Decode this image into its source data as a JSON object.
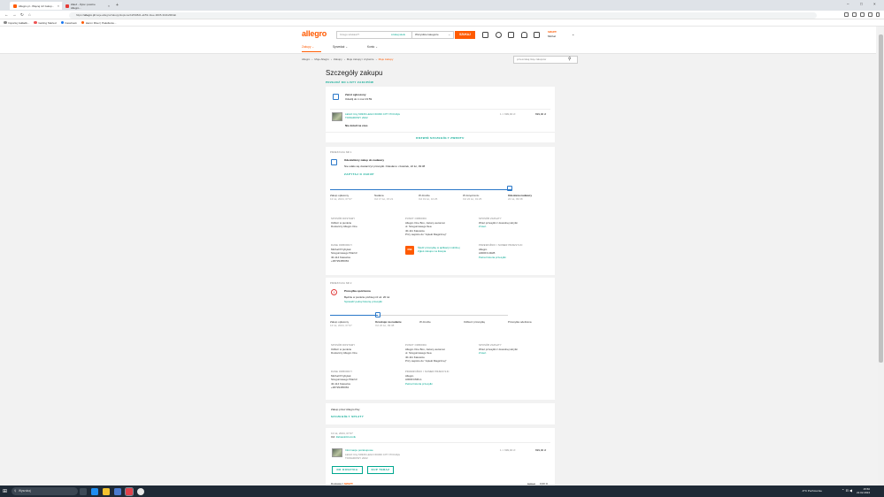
{
  "browser": {
    "tabs": [
      {
        "label": "Allegro.pl - Więcej niż zakup...",
        "active": true
      },
      {
        "label": "Zależ - Żyta i puszne Allegro...",
        "active": false
      }
    ],
    "url_prefix": "https://",
    "url_host": "allegro.pl",
    "url_path": "/moje-allegro/zakupy/kupione/b2f908d1-ab59-11ee-9005-3b4faf9f2ab",
    "bookmarks": [
      "Importuj zakładk...",
      "Getting Started",
      "Facebook",
      "Heron River | Pakollenie..."
    ]
  },
  "header": {
    "logo": "allegro",
    "search_placeholder": "Czego szukasz?",
    "search_here": "szukaj wielu",
    "category": "Wszystkie kategorie",
    "search_button": "SZUKAJ",
    "user_brand": "SMART!",
    "user_name": "Michał",
    "nav": [
      "Zakupy",
      "Sprzedaż",
      "Konto"
    ]
  },
  "breadcrumb": [
    "Allegro",
    "Moje Allegro",
    "Zakupy",
    "Moje zakupy i czytacze",
    "Moje zakupy"
  ],
  "purchase_search_placeholder": "przeszukaj listę zakupów",
  "page": {
    "title": "Szczegóły zakupu",
    "back_link": "PRZEJDŹ DO LISTY ZAKUPÓW"
  },
  "return": {
    "title": "Zwrot zgłoszony",
    "subtitle": "Odeślij do 1 mar 23:59",
    "product": "LEGO City 60336 LEGO 60336 CITY POCIĄG TOWAROWY 2022",
    "qty_price": "1 × 699,00 zł",
    "total": "699,00 zł",
    "note": "Nie dotarł na czas",
    "expand": "ROZWIŃ SZCZEGÓŁY ZWROTU"
  },
  "parcel1": {
    "label": "PRZESYŁKA NR 1",
    "status_title": "Odesłaliśmy zakup do nadawcy",
    "status_text": "Nie udało się dostarczyć przesyłki. Odesłano: czwartek, 22 lut, 09:38",
    "action": "ZAPYTAJ O ZAKUP",
    "timeline": [
      {
        "title": "Zakup opłacony",
        "date": "13 lut, 2024, 07:07"
      },
      {
        "title": "Nadana",
        "date": "Od 17 lut, 15:21"
      },
      {
        "title": "W drodze",
        "date": "Od 19 lut, 10:25"
      },
      {
        "title": "W doręczeniu",
        "date": "Od 22 lut, 01:25"
      },
      {
        "title": "Odesłana nadawcy",
        "date": "22 lut, 09:38"
      }
    ],
    "delivery_label": "SPOSÓB DOSTAWY",
    "delivery": [
      "Odbiór w punkcie",
      "Dostarczy Allegro One"
    ],
    "pickup_label": "PUNKT ODBIORU",
    "pickup": [
      "Allegro One Box, zielony automat",
      "ul. Szeguniowego 9ea",
      "40-111 Katowice",
      "Przy wejściu do \"Apteki Magicznej\""
    ],
    "payment_label": "SPOSÓB ZAPŁATY",
    "payment": [
      "Wraz przesyłki z dowolnej skrytki"
    ],
    "payment_link": "Zmień",
    "recipient_label": "DANE ODBIORCY",
    "recipient": [
      "Michał Przybyłek",
      "Szeguniowego 5/la/13",
      "40-114 Katowice",
      "+48729465063"
    ],
    "locker_text": "Śledź przesyłkę w aplikacji mobilnej",
    "locker_link": "Zgłoś zakupu na listopie",
    "locker_logo": "ONE",
    "carrier_label": "PRZEWOŹNIK I NUMER PRZESYŁKI",
    "carrier": [
      "Allegro",
      "A000FCJ4HB"
    ],
    "carrier_link": "Pełna historia przesyłki"
  },
  "parcel2": {
    "label": "PRZESYŁKA NR 2",
    "status_title": "Przesyłka opóźniona",
    "status_text": "Będzie w punkcie później niż wt. 20 lut",
    "status_link": "Sprawdź pełną historię przesyłki",
    "timeline": [
      {
        "title": "Zakup opłacony",
        "date": "13 lut, 2024, 07:07"
      },
      {
        "title": "Oczekuje na nadanie",
        "date": "Od 22 lut, 09:38"
      },
      {
        "title": "W drodze",
        "date": ""
      },
      {
        "title": "Odbierz przesyłkę",
        "date": ""
      },
      {
        "title": "Przesyłka odebrana",
        "date": ""
      }
    ],
    "delivery_label": "SPOSÓB DOSTAWY",
    "delivery": [
      "Odbiór w punkcie",
      "Dostarczy Allegro One"
    ],
    "pickup_label": "PUNKT ODBIORU",
    "pickup": [
      "Allegro One Box, zielony automat",
      "ul. Szeguniowego 9ea",
      "40-111 Katowice",
      "Przy wejściu do \"Apteki Magicznej\""
    ],
    "payment_label": "SPOSÓB ZAPŁATY",
    "payment": [
      "Wraz przesyłki z dowolnej skrytki"
    ],
    "payment_link": "Zmień",
    "recipient_label": "DANE ODBIORCY",
    "recipient": [
      "Michał Przybyłek",
      "Szeguniowego 5/la/13",
      "40-114 Katowice",
      "+48729465063"
    ],
    "carrier_label": "PRZEWOŹNIK I NUMER PRZESYŁKI",
    "carrier": [
      "Allegro",
      "A000FCMFL1"
    ],
    "carrier_link": "Pełna historia przesyłki"
  },
  "payment_card": {
    "text": "Zakup przez Allegro Pay",
    "link": "SZCZEGÓŁY SPŁATY"
  },
  "seller_card": {
    "date": "13 lut, 2024, 07:07",
    "from_prefix": "Od:",
    "seller": "Zabawki4zumnik",
    "info_title": "Informacje pozakupowe",
    "product": "LEGO City 60336 LEGO 60336 CITY POCIĄG TOWAROWY 2022",
    "qty_price": "1 × 699,00 zł",
    "total": "699,00 zł",
    "btn_cart": "DO KOSZYKA",
    "btn_buy": "KUP TERAZ",
    "delivery_line": "Dostawa z",
    "delivery_brand": "SMART!",
    "delivery_old": "8,99 zł",
    "delivery_price": "0,00 zł"
  },
  "taskbar": {
    "search": "Wyszukaj",
    "weather": "-6°C  Pochmurnie",
    "time": "15:50",
    "date": "22.02.2024"
  },
  "colors": {
    "brand": "#ff5a00",
    "link": "#00a790",
    "accent": "#2a78c9"
  }
}
